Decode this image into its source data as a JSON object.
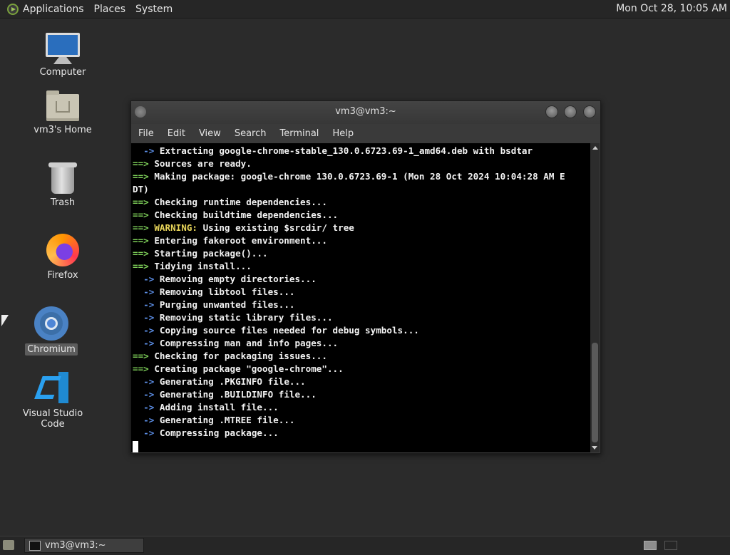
{
  "top_panel": {
    "menus": [
      "Applications",
      "Places",
      "System"
    ],
    "clock": "Mon Oct 28, 10:05 AM"
  },
  "desktop_icons": [
    {
      "label": "Computer",
      "icon": "computer-icon"
    },
    {
      "label": "vm3's Home",
      "icon": "home-folder-icon"
    },
    {
      "label": "Trash",
      "icon": "trash-icon"
    },
    {
      "label": "Firefox",
      "icon": "firefox-icon"
    },
    {
      "label": "Chromium",
      "icon": "chromium-icon",
      "selected": true
    },
    {
      "label": "Visual Studio Code",
      "icon": "vscode-icon"
    }
  ],
  "terminal": {
    "title": "vm3@vm3:~",
    "menus": [
      "File",
      "Edit",
      "View",
      "Search",
      "Terminal",
      "Help"
    ],
    "lines": [
      {
        "prefix": "  ->",
        "text": " Extracting google-chrome-stable_130.0.6723.69-1_amd64.deb with bsdtar"
      },
      {
        "prefix": "==>",
        "text": " Sources are ready."
      },
      {
        "prefix": "==>",
        "text": " Making package: google-chrome 130.0.6723.69-1 (Mon 28 Oct 2024 10:04:28 AM E"
      },
      {
        "prefix": "",
        "text": "DT)"
      },
      {
        "prefix": "==>",
        "text": " Checking runtime dependencies..."
      },
      {
        "prefix": "==>",
        "text": " Checking buildtime dependencies..."
      },
      {
        "prefix": "==>",
        "warning": " WARNING:",
        "text": " Using existing $srcdir/ tree"
      },
      {
        "prefix": "==>",
        "text": " Entering fakeroot environment..."
      },
      {
        "prefix": "==>",
        "text": " Starting package()..."
      },
      {
        "prefix": "==>",
        "text": " Tidying install..."
      },
      {
        "prefix": "  ->",
        "text": " Removing empty directories..."
      },
      {
        "prefix": "  ->",
        "text": " Removing libtool files..."
      },
      {
        "prefix": "  ->",
        "text": " Purging unwanted files..."
      },
      {
        "prefix": "  ->",
        "text": " Removing static library files..."
      },
      {
        "prefix": "  ->",
        "text": " Copying source files needed for debug symbols..."
      },
      {
        "prefix": "  ->",
        "text": " Compressing man and info pages..."
      },
      {
        "prefix": "==>",
        "text": " Checking for packaging issues..."
      },
      {
        "prefix": "==>",
        "text": " Creating package \"google-chrome\"..."
      },
      {
        "prefix": "  ->",
        "text": " Generating .PKGINFO file..."
      },
      {
        "prefix": "  ->",
        "text": " Generating .BUILDINFO file..."
      },
      {
        "prefix": "  ->",
        "text": " Adding install file..."
      },
      {
        "prefix": "  ->",
        "text": " Generating .MTREE file..."
      },
      {
        "prefix": "  ->",
        "text": " Compressing package..."
      }
    ]
  },
  "taskbar": {
    "task_label": "vm3@vm3:~"
  }
}
